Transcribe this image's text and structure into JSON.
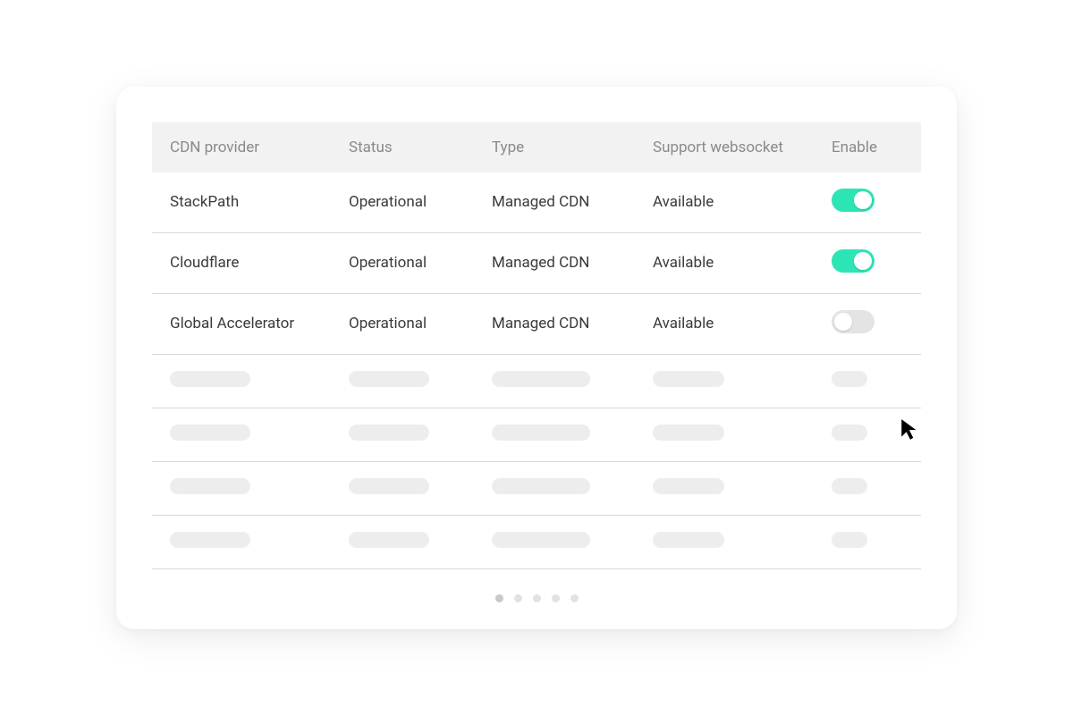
{
  "colors": {
    "toggle_on": "#2ce5b5",
    "toggle_off": "#e4e4e4",
    "text": "#3a3a3a",
    "muted": "#8a8a8a",
    "skeleton": "#ededed"
  },
  "table": {
    "headers": {
      "provider": "CDN provider",
      "status": "Status",
      "type": "Type",
      "websocket": "Support websocket",
      "enable": "Enable"
    },
    "rows": [
      {
        "provider": "StackPath",
        "status": "Operational",
        "type": "Managed CDN",
        "websocket": "Available",
        "enabled": true
      },
      {
        "provider": "Cloudflare",
        "status": "Operational",
        "type": "Managed CDN",
        "websocket": "Available",
        "enabled": true
      },
      {
        "provider": "Global Accelerator",
        "status": "Operational",
        "type": "Managed CDN",
        "websocket": "Available",
        "enabled": false
      }
    ],
    "skeleton_row_count": 4
  },
  "pagination": {
    "pages": 5,
    "current": 1
  }
}
